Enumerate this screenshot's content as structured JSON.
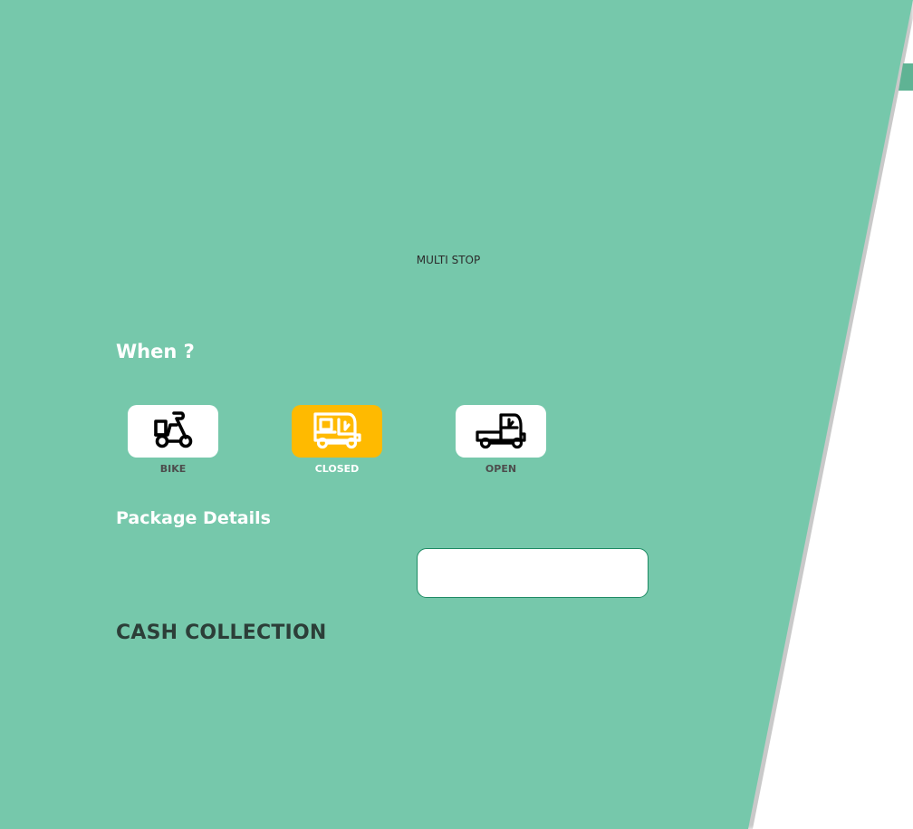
{
  "trip_type": {
    "label": "MULTI STOP"
  },
  "when": {
    "heading": "When ?"
  },
  "vehicles": [
    {
      "label": "BIKE",
      "icon": "scooter-icon",
      "selected": false
    },
    {
      "label": "CLOSED",
      "icon": "closed-auto-icon",
      "selected": true
    },
    {
      "label": "OPEN",
      "icon": "open-auto-icon",
      "selected": false
    }
  ],
  "package_details": {
    "heading": "Package Details",
    "input_value": ""
  },
  "cash_collection": {
    "heading": "CASH COLLECTION"
  },
  "colors": {
    "panel_green": "#76c8ab",
    "selected_yellow": "#ffba00",
    "input_border": "#1d8a63"
  }
}
